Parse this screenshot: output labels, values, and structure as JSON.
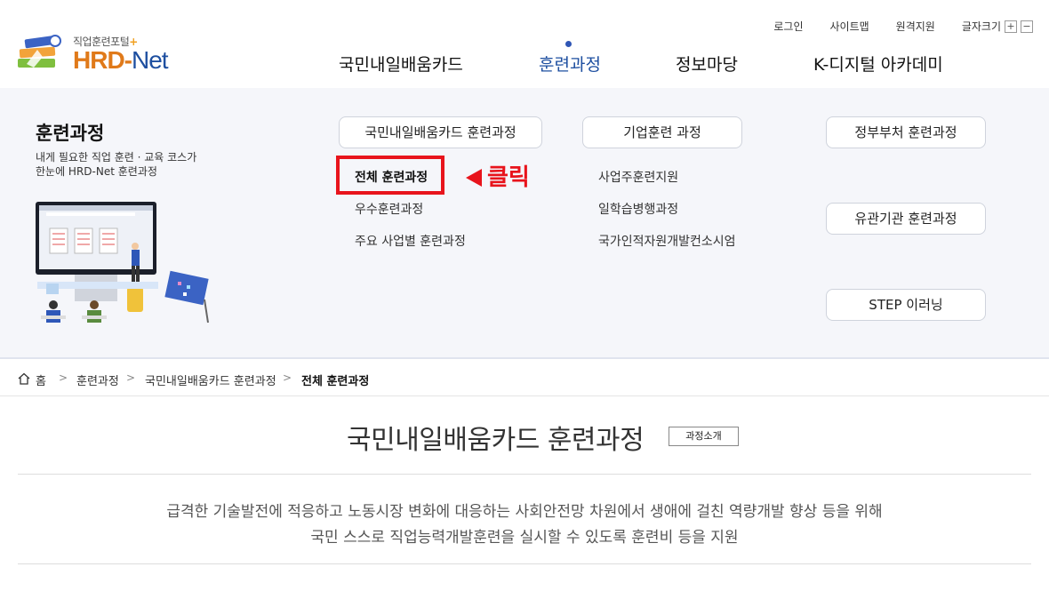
{
  "logo": {
    "top": "직업훈련포털",
    "plus": "+",
    "main": "HRD-",
    "net": "Net"
  },
  "util": {
    "login": "로그인",
    "sitemap": "사이트맵",
    "remote": "원격지원",
    "fontsize": "글자크기",
    "plus": "+",
    "minus": "−"
  },
  "gnb": [
    {
      "label": "국민내일배움카드"
    },
    {
      "label": "훈련과정"
    },
    {
      "label": "정보마당"
    },
    {
      "label": "K-디지털 아카데미"
    }
  ],
  "mega": {
    "title": "훈련과정",
    "desc_line1": "내게 필요한 직업 훈련 · 교육 코스가",
    "desc_line2": "한눈에 HRD-Net 훈련과정",
    "col1": {
      "header": "국민내일배움카드 훈련과정",
      "items": [
        "전체 훈련과정",
        "우수훈련과정",
        "주요 사업별 훈련과정"
      ]
    },
    "col2": {
      "header": "기업훈련 과정",
      "items": [
        "사업주훈련지원",
        "일학습병행과정",
        "국가인적자원개발컨소시엄"
      ]
    },
    "col3": [
      "정부부처 훈련과정",
      "유관기관 훈련과정",
      "STEP 이러닝"
    ],
    "annotation": "클릭"
  },
  "breadcrumb": {
    "home_icon": "home-icon",
    "home": "홈",
    "items": [
      "훈련과정",
      "국민내일배움카드 훈련과정",
      "전체 훈련과정"
    ]
  },
  "content": {
    "title": "국민내일배움카드 훈련과정",
    "intro_button": "과정소개",
    "desc_line1": "급격한 기술발전에 적응하고 노동시장 변화에 대응하는 사회안전망 차원에서 생애에 걸친 역량개발 향상 등을 위해",
    "desc_line2": "국민 스스로 직업능력개발훈련을 실시할 수 있도록 훈련비 등을 지원"
  },
  "colors": {
    "brand_blue": "#1e4fa0",
    "brand_orange": "#e07a1a",
    "highlight_red": "#e8141c"
  }
}
